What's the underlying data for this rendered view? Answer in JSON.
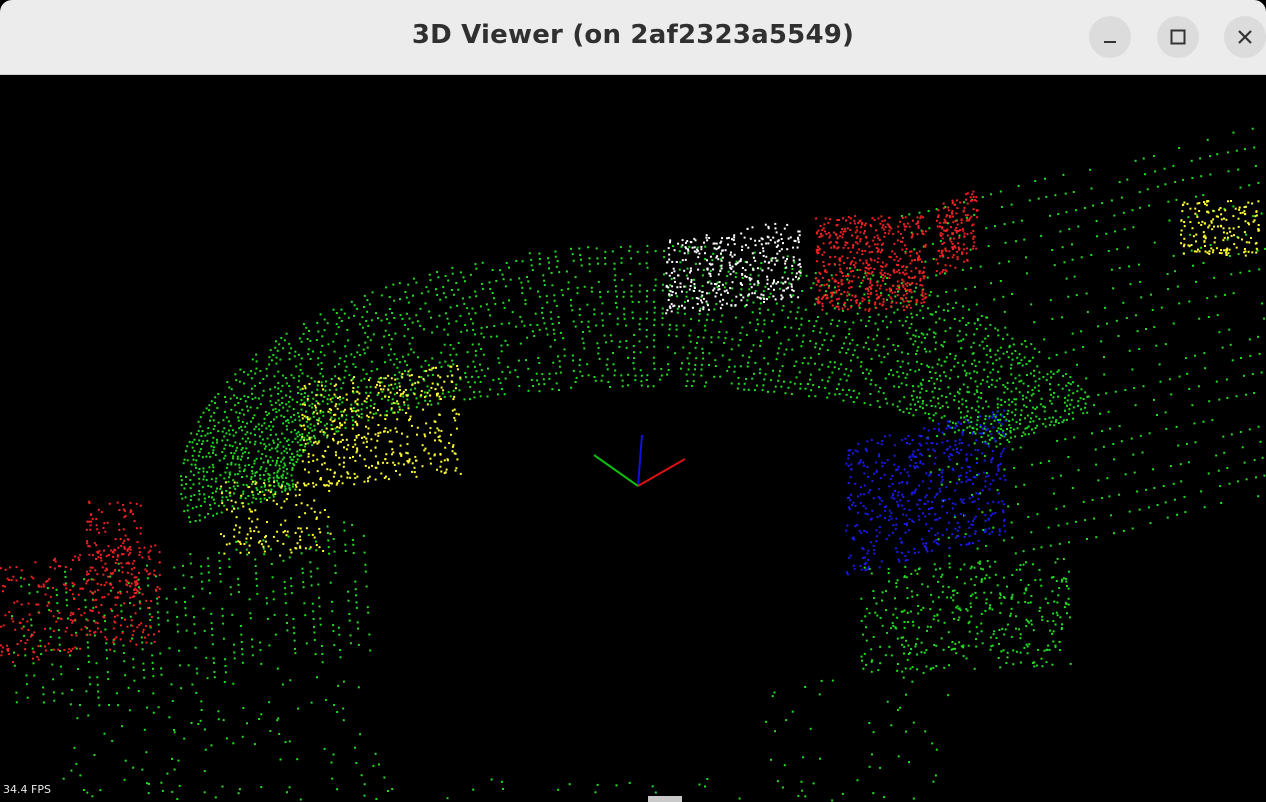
{
  "window": {
    "title": "3D Viewer (on 2af2323a5549)"
  },
  "controls": {
    "minimize_icon": "minimize-icon",
    "maximize_icon": "maximize-icon",
    "close_icon": "close-icon"
  },
  "viewer": {
    "fps_text": "34.4 FPS",
    "background_color": "#000000",
    "colors": {
      "ground": "#22dd22",
      "object_red": "#ee2222",
      "object_white": "#ffffff",
      "object_yellow": "#ffff33",
      "object_blue": "#1a1aee",
      "axis_x": "#dd1111",
      "axis_y": "#11bb11",
      "axis_z": "#1111dd"
    }
  }
}
